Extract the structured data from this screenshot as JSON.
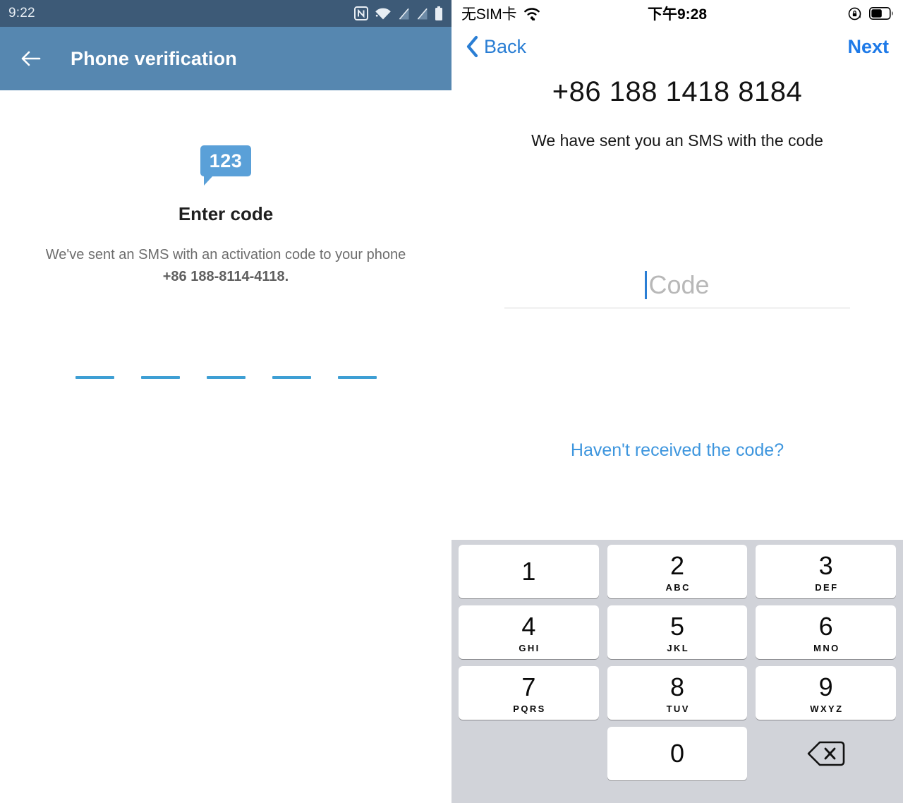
{
  "left_panel": {
    "platform": "android",
    "status_bar": {
      "clock": "9:22",
      "icons": [
        "nfc-icon",
        "wifi-icon",
        "no-signal-icon",
        "no-signal-icon",
        "battery-icon"
      ]
    },
    "app_bar": {
      "back_icon": "arrow-left-icon",
      "title": "Phone verification",
      "background_color": "#5687b0",
      "status_background_color": "#3d5a77"
    },
    "content": {
      "badge_icon": "sms-123-bubble-icon",
      "badge_text": "123",
      "badge_color": "#5aa0d8",
      "title": "Enter code",
      "description_line1": "We've sent an SMS with an activation code to your phone",
      "description_number": "+86 188-8114-4118.",
      "code_input_slots": 5,
      "code_input_value": "",
      "code_dash_color": "#3e9fd4"
    }
  },
  "right_panel": {
    "platform": "ios",
    "status_bar": {
      "carrier": "无SIM卡",
      "wifi_icon": "wifi-icon",
      "time": "下午9:28",
      "rotation_lock_icon": "rotation-lock-icon",
      "battery_icon": "battery-icon",
      "battery_level_percent": 55
    },
    "nav_bar": {
      "back_label": "Back",
      "back_icon": "chevron-left-icon",
      "next_label": "Next",
      "accent_color": "#2a7ed4"
    },
    "content": {
      "phone_number": "+86 188 1418 8184",
      "subtitle": "We have sent you an SMS with the code",
      "code_placeholder": "Code",
      "code_value": "",
      "resend_label": "Haven't received the code?",
      "link_color": "#3e96de"
    },
    "keyboard": {
      "type": "numeric-pad",
      "background_color": "#d1d3d9",
      "key_color": "#ffffff",
      "rows": [
        [
          {
            "digit": "1",
            "letters": ""
          },
          {
            "digit": "2",
            "letters": "ABC"
          },
          {
            "digit": "3",
            "letters": "DEF"
          }
        ],
        [
          {
            "digit": "4",
            "letters": "GHI"
          },
          {
            "digit": "5",
            "letters": "JKL"
          },
          {
            "digit": "6",
            "letters": "MNO"
          }
        ],
        [
          {
            "digit": "7",
            "letters": "PQRS"
          },
          {
            "digit": "8",
            "letters": "TUV"
          },
          {
            "digit": "9",
            "letters": "WXYZ"
          }
        ]
      ],
      "last_row": {
        "zero": "0",
        "backspace_icon": "backspace-icon"
      }
    }
  }
}
